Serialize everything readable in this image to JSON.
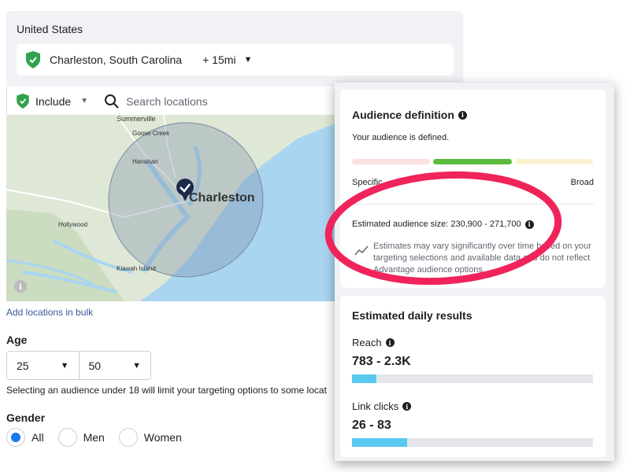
{
  "location": {
    "country": "United States",
    "city": "Charleston, South Carolina",
    "radius": "+ 15mi"
  },
  "search": {
    "include_label": "Include",
    "placeholder": "Search locations"
  },
  "map": {
    "labels": [
      "Summerville",
      "Goose Creek",
      "Hanahan",
      "Charleston",
      "Hollywood",
      "Kiawah Island"
    ]
  },
  "bulk_link": "Add locations in bulk",
  "age": {
    "title": "Age",
    "min": "25",
    "max": "50",
    "note": "Selecting an audience under 18 will limit your targeting options to some locat"
  },
  "gender": {
    "title": "Gender",
    "options": [
      "All",
      "Men",
      "Women"
    ],
    "selected": "All"
  },
  "audience": {
    "title": "Audience definition",
    "status": "Your audience is defined.",
    "specific_label": "Specific",
    "broad_label": "Broad",
    "estimated_size": "Estimated audience size: 230,900 - 271,700",
    "disclaimer": "Estimates may vary significantly over time based on your targeting selections and available data and do not reflect Advantage audience options.",
    "meter_colors": [
      "#fde0e0",
      "#5dbb3e",
      "#fdf2d0"
    ]
  },
  "daily": {
    "title": "Estimated daily results",
    "reach_label": "Reach",
    "reach_value": "783 - 2.3K",
    "reach_fill": 0.1,
    "clicks_label": "Link clicks",
    "clicks_value": "26 - 83",
    "clicks_fill": 0.23
  },
  "colors": {
    "accent": "#1877f2",
    "highlight": "#f0245a",
    "bar": "#5bc8f0",
    "pin": "#31a24c"
  }
}
